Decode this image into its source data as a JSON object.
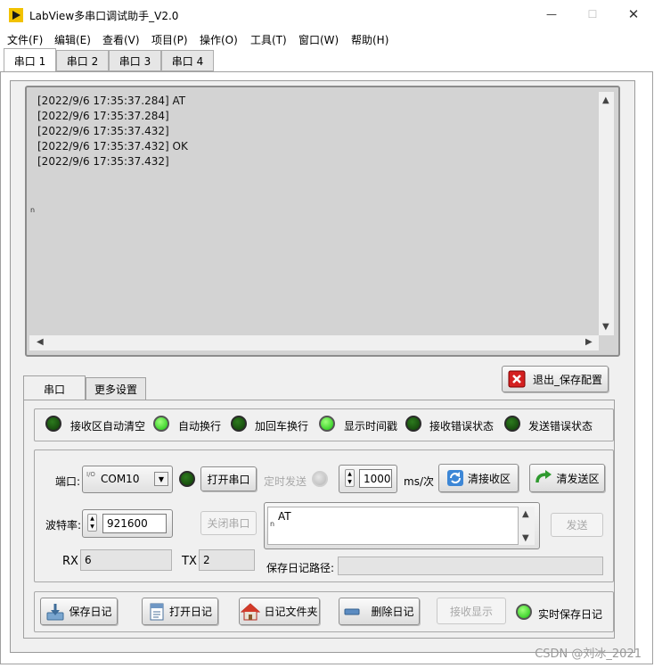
{
  "window": {
    "title": "LabView多串口调试助手_V2.0",
    "minimize": "—",
    "maximize": "☐",
    "close": "✕"
  },
  "menu": [
    "文件(F)",
    "编辑(E)",
    "查看(V)",
    "项目(P)",
    "操作(O)",
    "工具(T)",
    "窗口(W)",
    "帮助(H)"
  ],
  "port_tabs": [
    "串口 1",
    "串口 2",
    "串口 3",
    "串口 4"
  ],
  "receive": {
    "lines": [
      "[2022/9/6 17:35:37.284] AT",
      "[2022/9/6 17:35:37.284]",
      "[2022/9/6 17:35:37.432]",
      "[2022/9/6 17:35:37.432] OK",
      "[2022/9/6 17:35:37.432]"
    ],
    "side_marker": "n"
  },
  "exit_button": "退出_保存配置",
  "sub_tabs": [
    "串口",
    "更多设置"
  ],
  "indicators": [
    {
      "label": "接收区自动清空",
      "state": "off"
    },
    {
      "label": "自动换行",
      "state": "on"
    },
    {
      "label": "加回车换行",
      "state": "off"
    },
    {
      "label": "显示时间戳",
      "state": "on"
    },
    {
      "label": "接收错误状态",
      "state": "off"
    },
    {
      "label": "发送错误状态",
      "state": "off"
    }
  ],
  "config": {
    "port_label": "端口:",
    "port_prefix": "I/O",
    "port_value": "COM10",
    "open_button": "打开串口",
    "close_button": "关闭串口",
    "timed_send_label": "定时发送",
    "interval_value": "1000",
    "interval_unit": "ms/次",
    "clear_recv_button": "清接收区",
    "clear_send_button": "清发送区",
    "baud_label": "波特率:",
    "baud_value": "921600",
    "send_text": "AT",
    "send_marker": "n",
    "send_button": "发送",
    "rx_label": "RX",
    "rx_value": "6",
    "tx_label": "TX",
    "tx_value": "2",
    "log_path_label": "保存日记路径:",
    "log_path_value": ""
  },
  "bottom_buttons": {
    "save_log": "保存日记",
    "open_log": "打开日记",
    "log_folder": "日记文件夹",
    "delete_log": "删除日记",
    "recv_display": "接收显示",
    "realtime_save": "实时保存日记"
  },
  "watermark": "CSDN @刘冰_2021",
  "colors": {
    "led_on": "#19c10f",
    "led_off": "#0f3d08",
    "receive_bg": "#d3d3d3",
    "panel_bg": "#f0f0f0",
    "exit_icon": "#d42020"
  }
}
